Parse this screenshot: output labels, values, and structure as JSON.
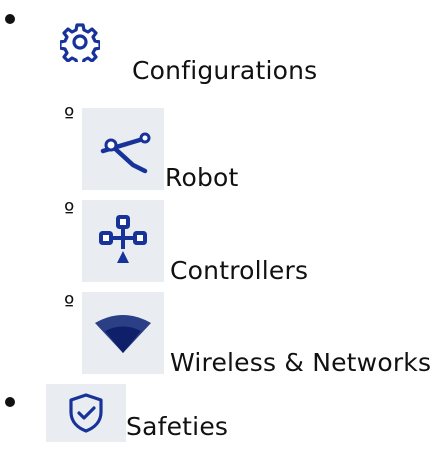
{
  "menu": {
    "items": [
      {
        "label": "Configurations",
        "icon": "gear-icon",
        "children": [
          {
            "label": "Robot",
            "icon": "robot-arm-icon"
          },
          {
            "label": "Controllers",
            "icon": "controller-nodes-icon"
          },
          {
            "label": "Wireless & Networks",
            "icon": "wifi-icon"
          }
        ]
      },
      {
        "label": "Safeties",
        "icon": "shield-check-icon"
      }
    ]
  },
  "colors": {
    "icon_blue": "#17339a",
    "tile_bg": "#e9edf2",
    "text": "#111111"
  }
}
